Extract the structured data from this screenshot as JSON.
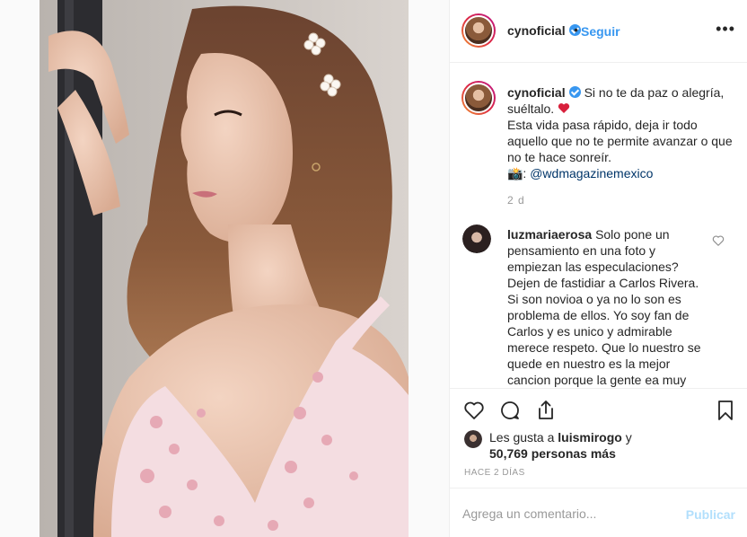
{
  "post": {
    "author": "cynoficial",
    "follow_label": "Seguir",
    "separator": "•",
    "more_label": "•••",
    "caption": {
      "line1": "Si no te da paz o alegría, suéltalo.",
      "line2": "Esta vida pasa rápido, deja ir todo aquello que no te permite avanzar o que no te hace sonreír.",
      "credit_prefix": "📸:",
      "mention": "@wdmagazinemexico",
      "time": "2 d"
    },
    "comment": {
      "user": "luzmariaerosa",
      "text": "Solo pone un pensamiento en una foto y empiezan las especulaciones? Dejen de fastidiar a Carlos Rivera. Si son novioa o ya no lo son es problema de ellos. Yo soy fan de Carlos y es unico y admirable merece respeto. Que lo nuestro se quede en nuestro es la mejor cancion porque la gente ea muy"
    },
    "likes": {
      "prefix": "Les gusta a",
      "user": "luismirogo",
      "suffix": "y",
      "count_text": "50,769 personas más"
    },
    "posted_ago": "HACE 2 DÍAS",
    "comment_box": {
      "placeholder": "Agrega un comentario...",
      "submit_label": "Publicar"
    }
  },
  "colors": {
    "link_blue": "#3897f0",
    "mention_blue": "#003569",
    "muted": "#999999",
    "publish_disabled": "#b2dffc"
  }
}
